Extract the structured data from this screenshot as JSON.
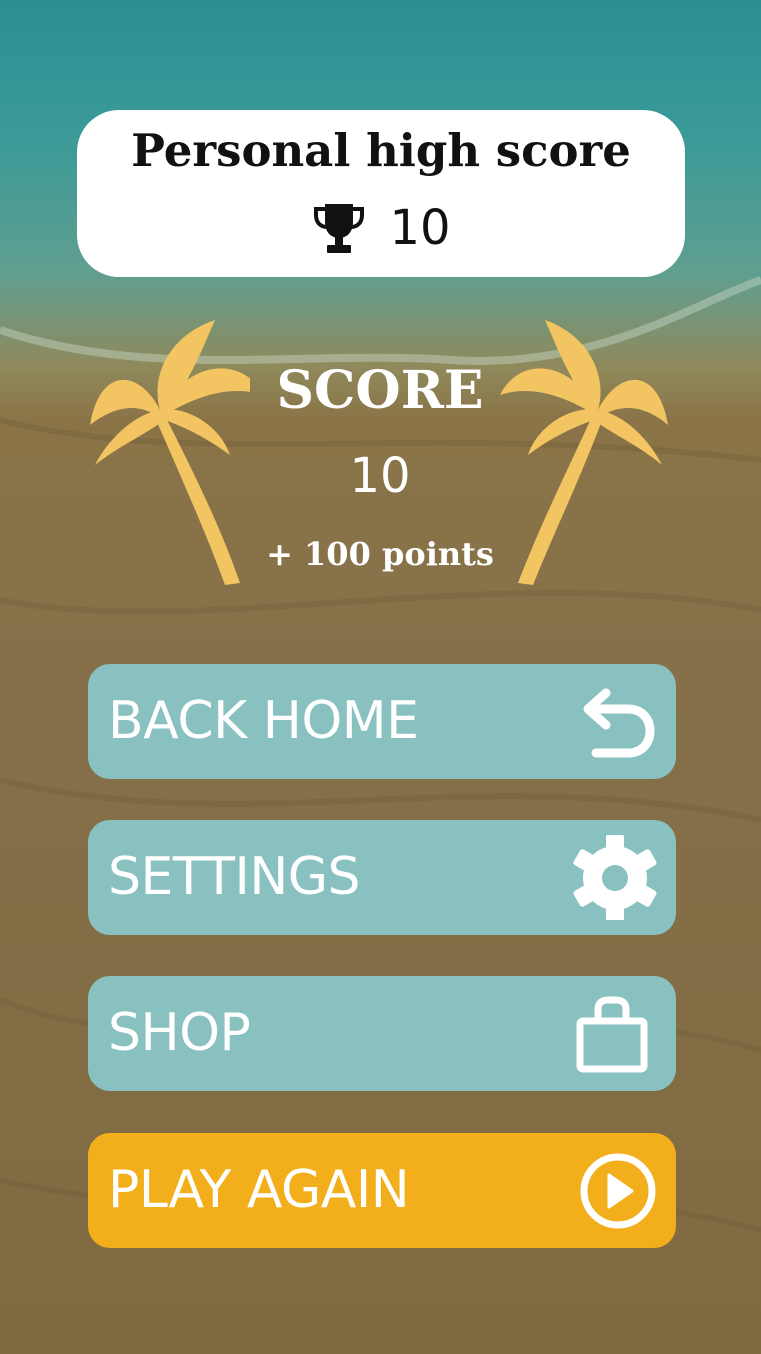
{
  "high_score": {
    "title": "Personal high score",
    "icon": "trophy-icon",
    "value": "10"
  },
  "score": {
    "label": "SCORE",
    "value": "10",
    "points": "+ 100 points"
  },
  "buttons": {
    "back_home": {
      "label": "BACK HOME",
      "icon": "undo-arrow-icon"
    },
    "settings": {
      "label": "SETTINGS",
      "icon": "gear-icon"
    },
    "shop": {
      "label": "SHOP",
      "icon": "shopping-bag-icon"
    },
    "play_again": {
      "label": "PLAY AGAIN",
      "icon": "play-circle-icon"
    }
  },
  "colors": {
    "water": "#2b8f93",
    "sand": "#85704a",
    "button": "#88c1bf",
    "play_button": "#f2af1b",
    "palm": "#f2c562"
  }
}
